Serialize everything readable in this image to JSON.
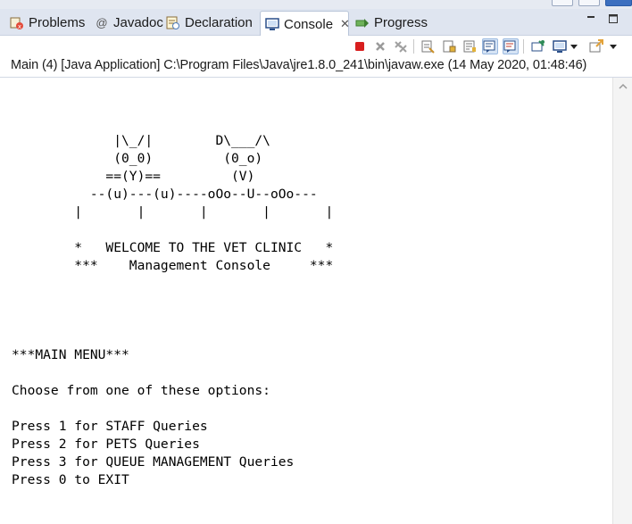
{
  "tabs": [
    {
      "label": "Problems",
      "icon": "problems-icon",
      "active": false
    },
    {
      "label": "Javadoc",
      "icon": "javadoc-icon",
      "active": false
    },
    {
      "label": "Declaration",
      "icon": "declaration-icon",
      "active": false
    },
    {
      "label": "Console",
      "icon": "console-icon",
      "active": true
    },
    {
      "label": "Progress",
      "icon": "progress-icon",
      "active": false
    }
  ],
  "tab_prefix_javadoc": "@",
  "toolbar": {
    "buttons": [
      "terminate-icon",
      "remove-launch-icon",
      "remove-all-terminated-icon",
      "clear-console-icon",
      "scroll-lock-icon",
      "word-wrap-icon",
      "show-stdout-icon",
      "show-stderr-icon",
      "pin-console-icon",
      "display-console-icon",
      "open-console-icon"
    ]
  },
  "launch_description": "Main (4) [Java Application] C:\\Program Files\\Java\\jre1.8.0_241\\bin\\javaw.exe (14 May 2020, 01:48:46)",
  "console": {
    "lines": [
      "",
      "             |\\_/|        D\\___/\\",
      "             (0_0)         (0_o)",
      "            ==(Y)==         (V)",
      "          --(u)---(u)----oOo--U--oOo---",
      "        |       |       |       |       |",
      "",
      "        *   WELCOME TO THE VET CLINIC   *",
      "        ***    Management Console     ***",
      "",
      "",
      "",
      "",
      "***MAIN MENU***",
      "",
      "Choose from one of these options:",
      "",
      "Press 1 for STAFF Queries",
      "Press 2 for PETS Queries",
      "Press 3 for QUEUE MANAGEMENT Queries",
      "Press 0 to EXIT"
    ]
  },
  "colors": {
    "tab_bar_bg": "#dfe5f0",
    "terminate_red": "#d81e1e",
    "console_text": "#000000"
  }
}
